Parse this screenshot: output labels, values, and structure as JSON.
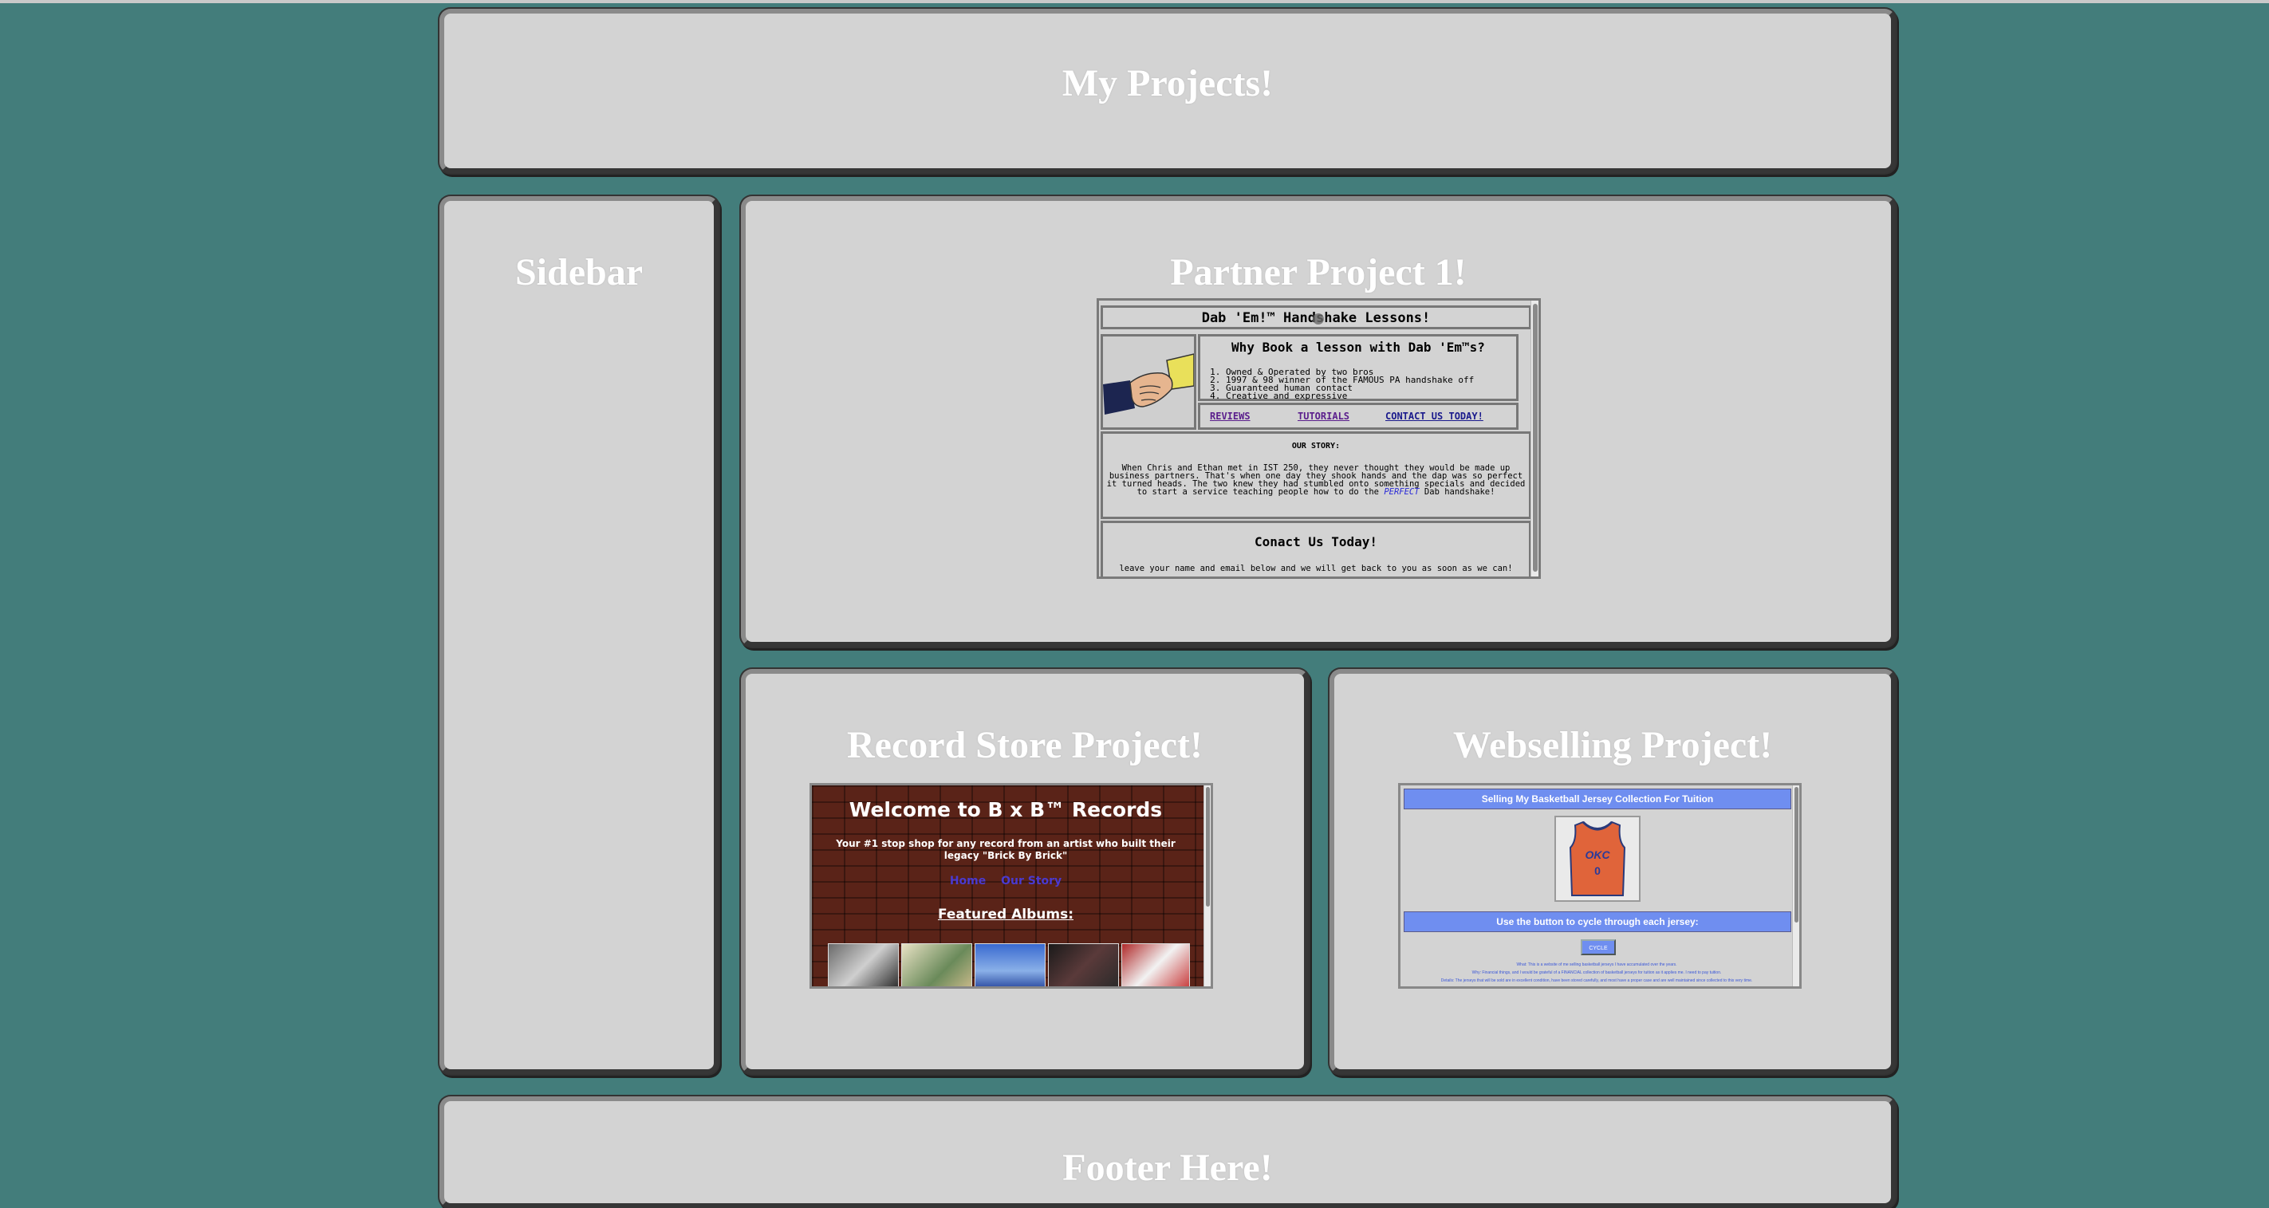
{
  "header": {
    "title": "My Projects!"
  },
  "sidebar": {
    "title": "Sidebar"
  },
  "partner": {
    "title": "Partner Project 1!",
    "site": {
      "title": "Dab 'Em!™ Handshake Lessons!",
      "why_title": "Why Book a lesson with Dab 'Em™s?",
      "reasons": [
        "Owned & Operated by two bros",
        "1997 & 98 winner of the FAMOUS PA handshake off",
        "Guaranteed human contact",
        "Creative and expressive"
      ],
      "nav": [
        "REVIEWS",
        "TUTORIALS",
        "CONTACT US TODAY!"
      ],
      "story_title": "OUR STORY:",
      "story_text": "When Chris and Ethan met in IST 250, they never thought they would be made up business partners. That's when one day they shook hands and the dap was so perfect it turned heads. The two knew they had stumbled onto something specials and decided to start a service teaching people how to do the",
      "story_highlight": "PERFECT",
      "story_end": "Dab handshake!",
      "contact_title": "Conact Us Today!",
      "contact_text": "leave your name and email below and we will get back to you as soon as we can!"
    }
  },
  "record": {
    "title": "Record Store Project!",
    "site": {
      "heading": "Welcome to B x B™ Records",
      "tagline": "Your #1 stop shop for any record from an artist who built their legacy \"Brick By Brick\"",
      "nav": [
        "Home",
        "Our Story"
      ],
      "featured": "Featured Albums:"
    }
  },
  "webselling": {
    "title": "Webselling Project!",
    "site": {
      "banner": "Selling My Basketball Jersey Collection For Tuition",
      "jersey_text": "OKC",
      "jersey_number": "0",
      "instruction": "Use the button to cycle through each jersey:",
      "button": "CYCLE",
      "lines": [
        "What: This is a website of me selling basketball jerseys I have accumulated over the years.",
        "Why: Financial things, and I would be grateful of a FINANCIAL collection of basketball jerseys for tuition as it applies me. I need to pay tuition.",
        "Details: The jerseys that will be sold are in excellent condition, have been stored carefully, and most have a proper case and are well maintained since collected to this very time."
      ]
    }
  },
  "footer": {
    "title": "Footer Here!"
  },
  "colors": {
    "background": "#437d7b",
    "panel": "#d3d3d3",
    "web_bar": "#6f8ef0",
    "brick": "#5a2318"
  }
}
